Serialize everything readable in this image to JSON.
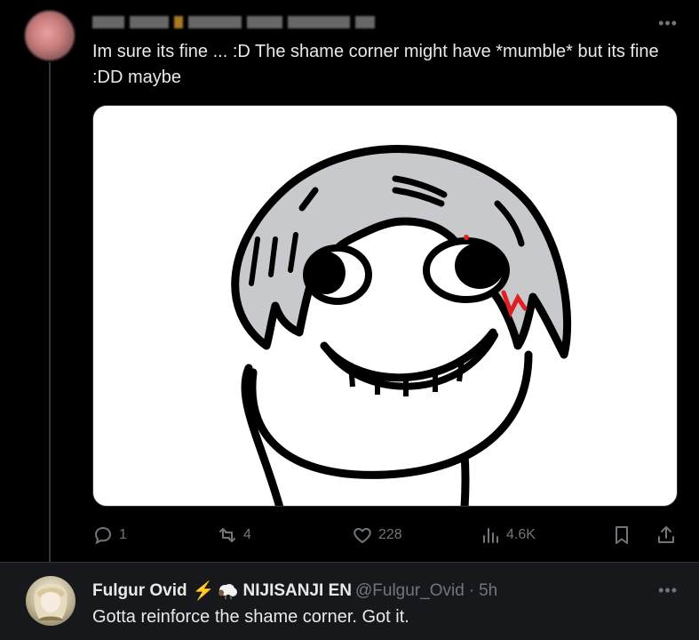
{
  "tweet": {
    "text": "Im sure its fine ... :D The shame corner might have *mumble* but its fine :DD maybe",
    "more_icon": "more-horizontal-icon",
    "stats": {
      "replies": "1",
      "reposts": "4",
      "likes": "228",
      "views": "4.6K"
    }
  },
  "reply": {
    "display_name": "Fulgur Ovid",
    "affiliation": "NIJISANJI EN",
    "handle": "@Fulgur_Ovid",
    "separator": "·",
    "time": "5h",
    "text": "Gotta reinforce the shame corner. Got it."
  },
  "colors": {
    "background": "#000000",
    "reply_background": "#16181c",
    "text_primary": "#e7e9ea",
    "text_secondary": "#71767b",
    "divider": "#2f3336"
  }
}
